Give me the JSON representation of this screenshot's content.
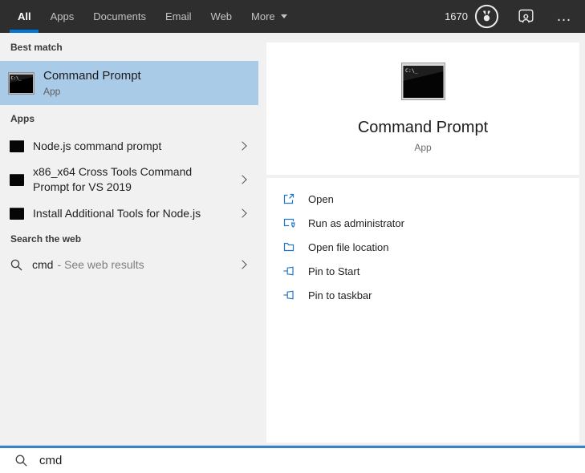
{
  "topbar": {
    "tabs": [
      {
        "label": "All",
        "selected": true
      },
      {
        "label": "Apps"
      },
      {
        "label": "Documents"
      },
      {
        "label": "Email"
      },
      {
        "label": "Web"
      }
    ],
    "more_label": "More",
    "rewards_points": "1670",
    "ellipsis": "…"
  },
  "left_panel": {
    "best_match": {
      "header": "Best match",
      "item": {
        "title": "Command Prompt",
        "subtitle": "App"
      }
    },
    "apps": {
      "header": "Apps",
      "items": [
        {
          "label": "Node.js command prompt"
        },
        {
          "label": "x86_x64 Cross Tools Command Prompt for VS 2019"
        },
        {
          "label": "Install Additional Tools for Node.js"
        }
      ]
    },
    "web": {
      "header": "Search the web",
      "item": {
        "query": "cmd",
        "suffix": "- See web results"
      }
    }
  },
  "preview": {
    "title": "Command Prompt",
    "subtitle": "App",
    "actions": [
      {
        "label": "Open"
      },
      {
        "label": "Run as administrator"
      },
      {
        "label": "Open file location"
      },
      {
        "label": "Pin to Start"
      },
      {
        "label": "Pin to taskbar"
      }
    ]
  },
  "search_bar": {
    "value": "cmd"
  },
  "icons": {
    "rewards-medal-icon": "circled medal badge",
    "feedback-person-icon": "person in frame",
    "more-options-icon": "ellipsis dots",
    "cmd-terminal-icon": "black terminal window",
    "chevron-right-icon": "right angle chevron",
    "search-icon": "magnifier",
    "open-icon": "window with launch arrow",
    "run-as-admin-icon": "window with shield",
    "open-file-location-icon": "folder outline",
    "pin-icon": "pushpin flag",
    "dropdown-arrow-icon": "filled down triangle"
  },
  "colors": {
    "accent_blue": "#0078d7",
    "topbar_bg": "#2e2e2e",
    "best_match_highlight": "#a9cbe8",
    "panel_bg": "#f1f1f1",
    "card_bg": "#ffffff",
    "action_icon_blue": "#2476c8"
  }
}
